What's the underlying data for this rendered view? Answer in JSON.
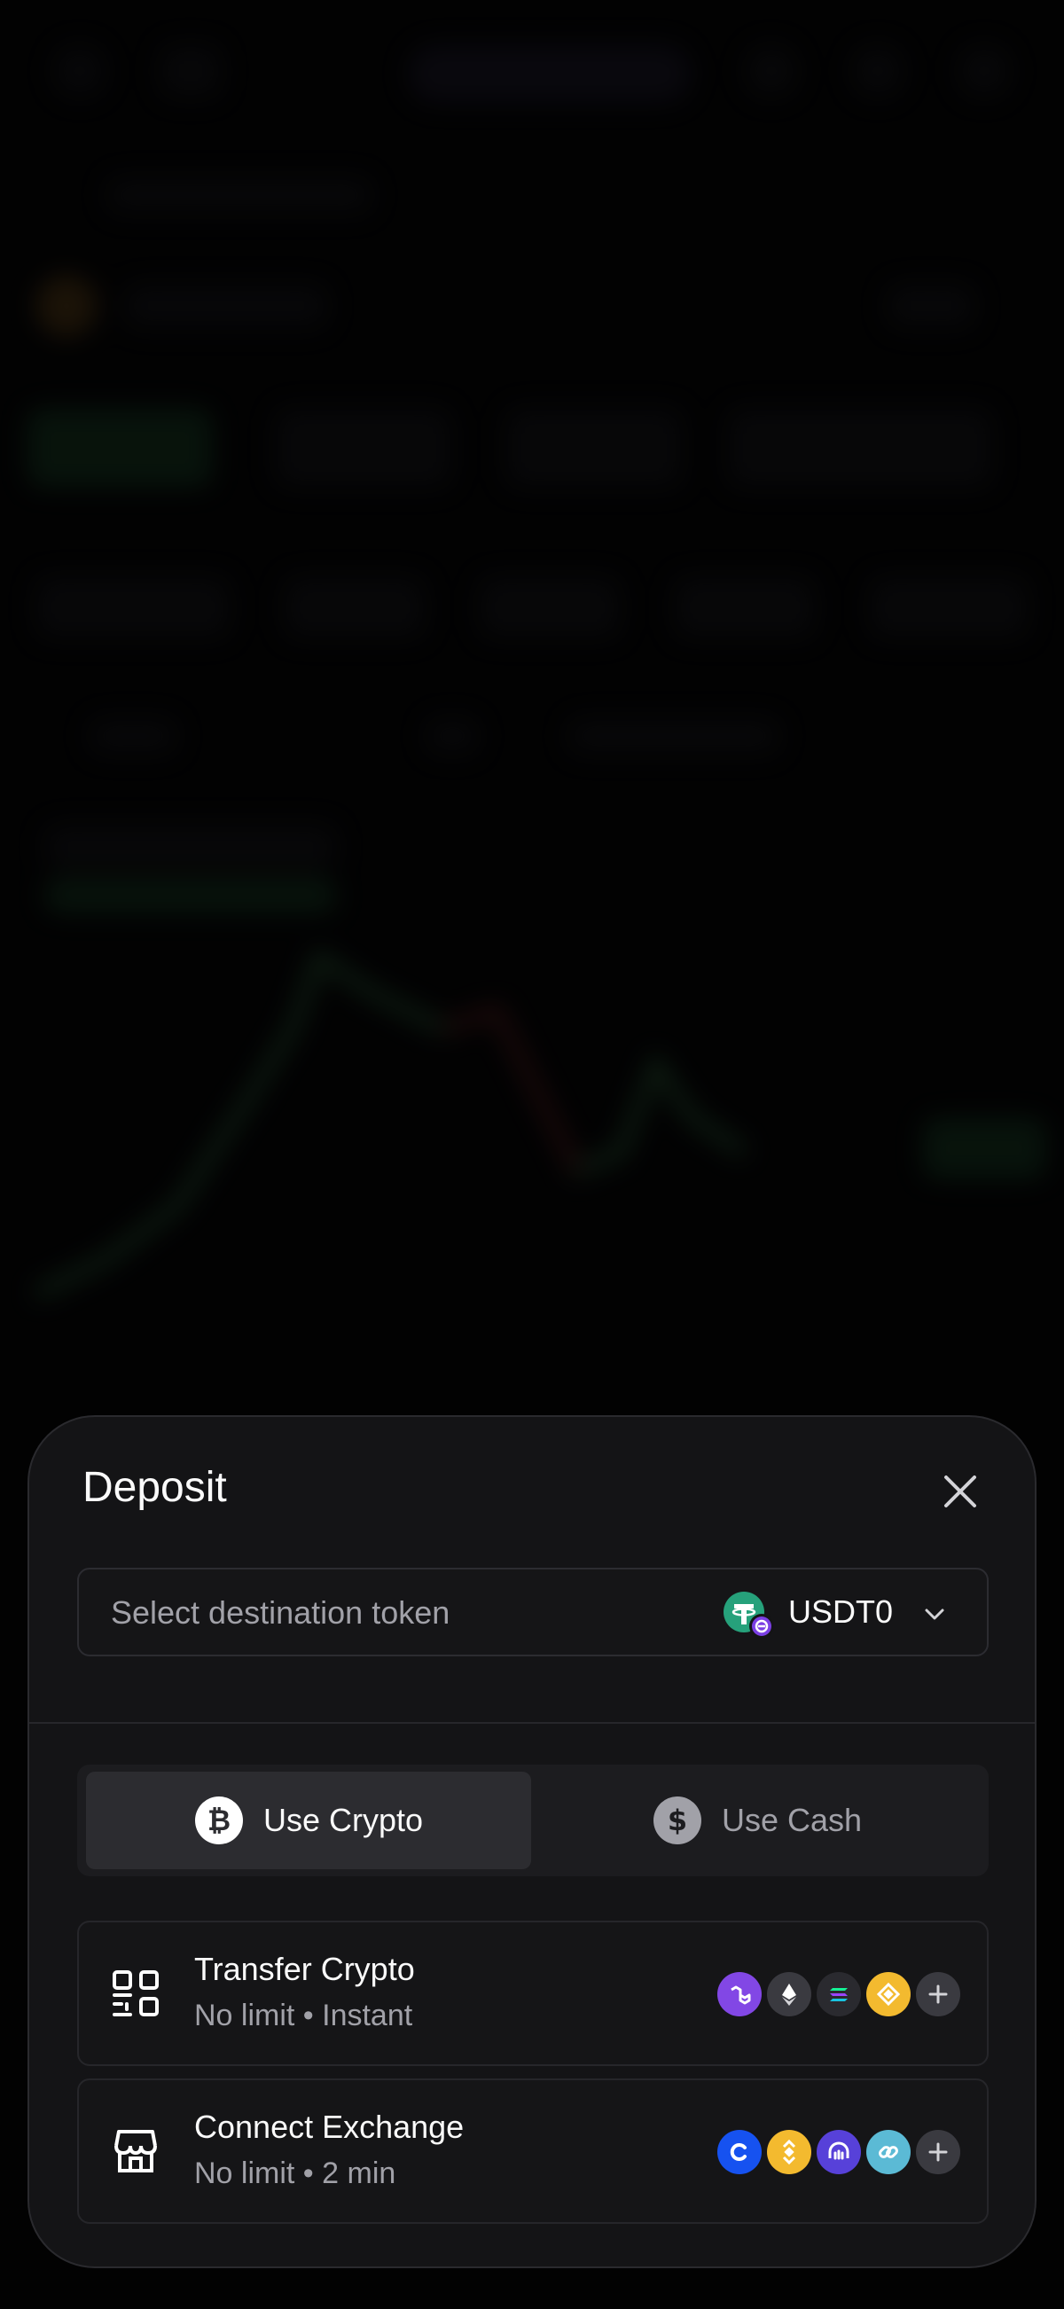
{
  "deposit": {
    "title": "Deposit",
    "close_icon": "close-icon",
    "token_select": {
      "placeholder": "Select destination token",
      "selected_symbol": "USDT0",
      "token_icon": "tether-icon",
      "chevron_icon": "chevron-down-icon"
    },
    "tabs": [
      {
        "label": "Use Crypto",
        "icon": "bitcoin-icon",
        "active": true
      },
      {
        "label": "Use Cash",
        "icon": "dollar-icon",
        "active": false
      }
    ],
    "options": [
      {
        "title": "Transfer Crypto",
        "subtitle": "No limit • Instant",
        "icon": "qr-code-icon",
        "chips": [
          "polygon-icon",
          "ethereum-icon",
          "solana-icon",
          "bnb-icon",
          "plus-icon"
        ]
      },
      {
        "title": "Connect Exchange",
        "subtitle": "No limit • 2 min",
        "icon": "storefront-icon",
        "chips": [
          "coinbase-icon",
          "binance-icon",
          "kraken-icon",
          "chainlink-icon",
          "plus-icon"
        ]
      }
    ]
  },
  "colors": {
    "sheet_bg": "#141416",
    "active_tab_bg": "#2c2c30",
    "tether_green": "#26a17b",
    "polygon_purple": "#8247e5",
    "binance_yellow": "#f3ba2f",
    "coinbase_blue": "#1652f0",
    "kraken_purple": "#5741d9"
  }
}
